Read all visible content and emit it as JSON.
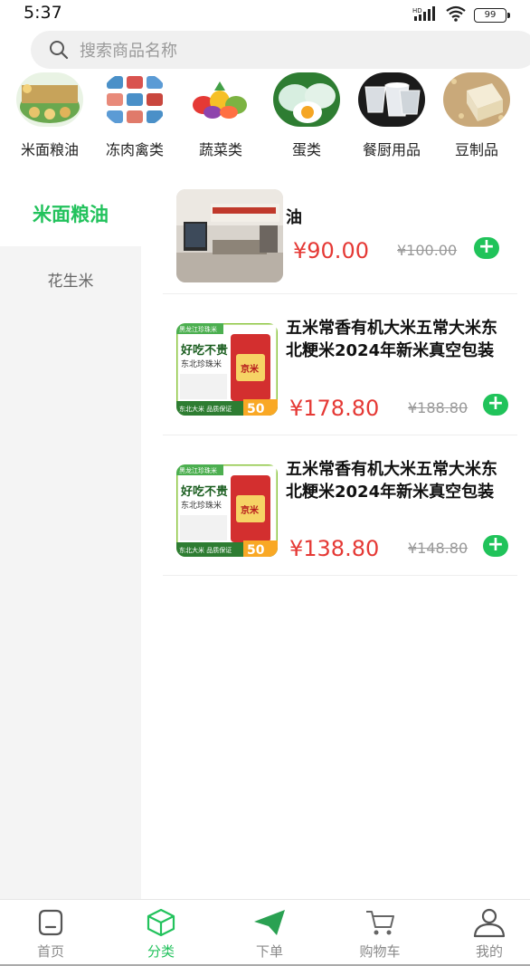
{
  "status": {
    "time": "5:37",
    "battery": "99",
    "network": "HD"
  },
  "search": {
    "placeholder": "搜索商品名称"
  },
  "categories": [
    {
      "label": "米面粮油",
      "icon": "grain-oil-image"
    },
    {
      "label": "冻肉禽类",
      "icon": "frozen-meat-image"
    },
    {
      "label": "蔬菜类",
      "icon": "vegetables-image"
    },
    {
      "label": "蛋类",
      "icon": "eggs-image"
    },
    {
      "label": "餐厨用品",
      "icon": "kitchenware-image"
    },
    {
      "label": "豆制品",
      "icon": "tofu-image"
    }
  ],
  "sidebar": {
    "items": [
      {
        "label": "米面粮油",
        "active": true
      },
      {
        "label": "花生米",
        "active": false
      }
    ]
  },
  "products": [
    {
      "name": "油",
      "price": "¥90.00",
      "old_price": "¥100.00"
    },
    {
      "name": "五米常香有机大米五常大米东北粳米2024年新米真空包装",
      "price": "¥178.80",
      "old_price": "¥188.80"
    },
    {
      "name": "五米常香有机大米五常大米东北粳米2024年新米真空包装",
      "price": "¥138.80",
      "old_price": "¥148.80"
    }
  ],
  "product_images": {
    "rice_bag": {
      "tag": "黑龙江珍珠米",
      "slogan": "好吃不贵",
      "sub": "东北珍珠米",
      "badge": "东北大米 品质保证",
      "weight": "50",
      "bag_text": "京米"
    }
  },
  "tabbar": {
    "items": [
      {
        "label": "首页",
        "icon": "home-icon",
        "active": false
      },
      {
        "label": "分类",
        "icon": "category-box-icon",
        "active": true
      },
      {
        "label": "下单",
        "icon": "send-order-icon",
        "active": false
      },
      {
        "label": "购物车",
        "icon": "cart-icon",
        "active": false
      },
      {
        "label": "我的",
        "icon": "profile-icon",
        "active": false
      }
    ]
  },
  "colors": {
    "accent": "#22c25c",
    "price": "#e53935",
    "add_button": "#20c35a"
  }
}
